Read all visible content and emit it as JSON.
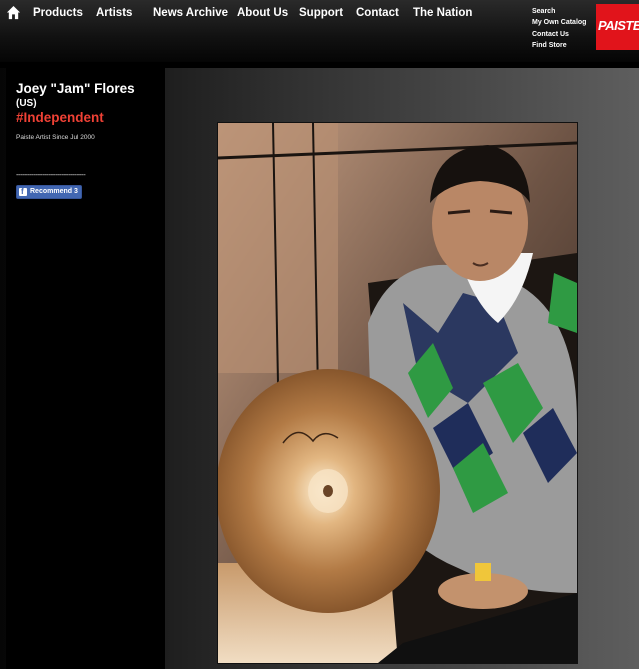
{
  "nav": {
    "items": [
      "Products",
      "Artists",
      "News Archive",
      "About Us",
      "Support",
      "Contact",
      "The Nation"
    ]
  },
  "utility": {
    "items": [
      "Search",
      "My Own Catalog",
      "Contact Us",
      "Find Store"
    ]
  },
  "logo": {
    "text": "PAISTE",
    "color": "#e1141b"
  },
  "artist": {
    "name": "Joey \"Jam\" Flores",
    "country": "(US)",
    "tag": "#Independent",
    "since": "Paiste Artist Since Jul 2000"
  },
  "sidebar": {
    "divider": "--------------------------------",
    "recommend_label": "Recommend 3"
  },
  "icons": {
    "home": "home-icon",
    "facebook": "facebook-icon"
  },
  "colors": {
    "accent": "#ef4135",
    "facebook": "#4267b2"
  }
}
